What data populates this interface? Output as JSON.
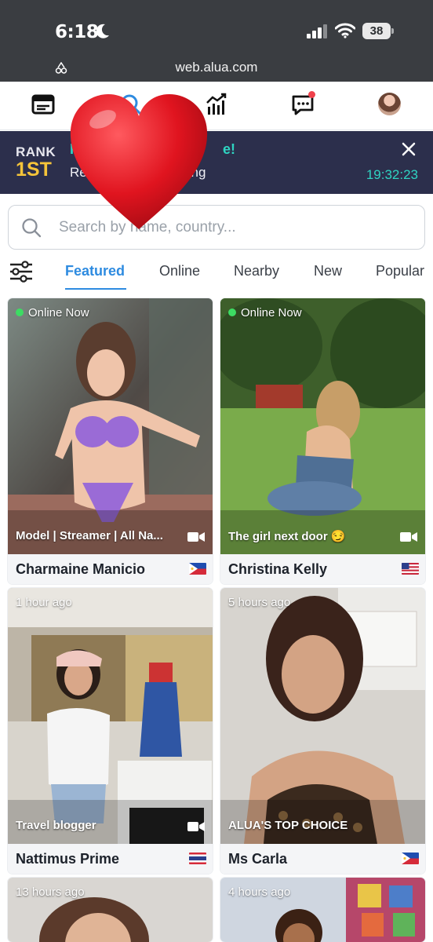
{
  "status_bar": {
    "time": "6:18",
    "battery": "38"
  },
  "url_bar": {
    "url": "web.alua.com"
  },
  "nav": {
    "items": [
      {
        "name": "feed",
        "icon": "browser-window-icon"
      },
      {
        "name": "search",
        "icon": "search-icon"
      },
      {
        "name": "stats",
        "icon": "chart-icon"
      },
      {
        "name": "messages",
        "icon": "chat-icon",
        "has_notification": true
      },
      {
        "name": "profile",
        "icon": "avatar"
      }
    ]
  },
  "banner": {
    "rank_label": "RANK",
    "rank_value": "1ST",
    "title_start": "R",
    "title_end": "e!",
    "subtitle_start": "Re",
    "subtitle_end": "ing",
    "timer": "19:32:23",
    "accent_color": "#2fd4c2",
    "rank_color": "#f5c43a"
  },
  "search": {
    "placeholder": "Search by name, country..."
  },
  "tabs": [
    {
      "label": "Featured",
      "active": true
    },
    {
      "label": "Online"
    },
    {
      "label": "Nearby"
    },
    {
      "label": "New"
    },
    {
      "label": "Popular"
    }
  ],
  "creators": [
    {
      "status": "Online Now",
      "online": true,
      "tagline": "Model | Streamer | All Na...",
      "name": "Charmaine Manicio",
      "flag": "Philippines"
    },
    {
      "status": "Online Now",
      "online": true,
      "tagline": "The girl next door 😏",
      "name": "Christina Kelly",
      "flag": "United States"
    },
    {
      "status": "1 hour ago",
      "online": false,
      "tagline": "Travel blogger",
      "name": "Nattimus Prime",
      "flag": "Thailand"
    },
    {
      "status": "5 hours ago",
      "online": false,
      "tagline": "ALUA'S TOP CHOICE",
      "name": "Ms Carla",
      "flag": "Philippines"
    },
    {
      "status": "13 hours ago",
      "online": false
    },
    {
      "status": "4 hours ago",
      "online": false
    }
  ],
  "overlay": {
    "sticker": "heart"
  }
}
